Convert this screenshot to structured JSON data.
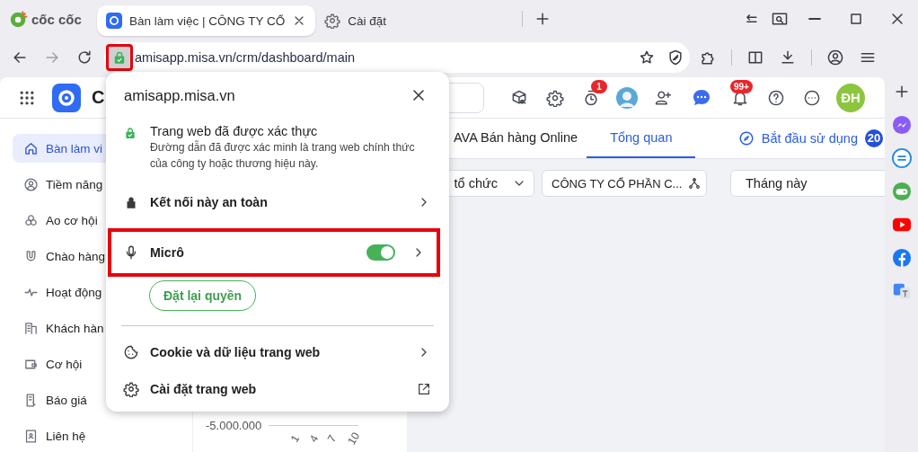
{
  "browser": {
    "brand": "cốc cốc",
    "tabs": [
      {
        "kind": "app",
        "title": "Bàn làm việc | CÔNG TY CỔ",
        "selected": true
      },
      {
        "kind": "settings",
        "title": "Cài đặt",
        "selected": false
      }
    ],
    "address": {
      "url": "amisapp.misa.vn/crm/dashboard/main",
      "lock_highlighted": true
    }
  },
  "app": {
    "title": "C",
    "timer_badge": "1",
    "bell_badge": "99+",
    "user_initials": "ĐH",
    "sidebar": [
      {
        "label": "Bàn làm vi",
        "selected": true
      },
      {
        "label": "Tiềm năng",
        "selected": false
      },
      {
        "label": "Ao cơ hội",
        "selected": false
      },
      {
        "label": "Chào hàng",
        "selected": false
      },
      {
        "label": "Hoạt động",
        "selected": false
      },
      {
        "label": "Khách hàn",
        "selected": false
      },
      {
        "label": "Cơ hội",
        "selected": false
      },
      {
        "label": "Báo giá",
        "selected": false
      },
      {
        "label": "Liên hệ",
        "selected": false
      }
    ],
    "tabs": [
      {
        "label": "AVA Bán hàng Online",
        "selected": false
      },
      {
        "label": "Tổng quan",
        "selected": true
      }
    ],
    "get_started": {
      "label": "Bắt đầu sử dụng",
      "count": "20"
    },
    "filters": [
      {
        "kind": "dropdown",
        "label": "tổ chức"
      },
      {
        "kind": "org",
        "label": "CÔNG TY CỔ PHẦN C..."
      },
      {
        "kind": "plain",
        "label": "Tháng này"
      }
    ],
    "chart": {
      "y_tick": "-5.000.000",
      "x_ticks": [
        "1",
        "4",
        "7",
        "10"
      ]
    }
  },
  "popup": {
    "site": "amisapp.misa.vn",
    "verified_title": "Trang web đã được xác thực",
    "verified_text": "Đường dẫn đã được xác minh là trang web chính thức của công ty hoặc thương hiệu này.",
    "rows": [
      {
        "kind": "link",
        "label": "Kết nối này an toàn",
        "highlighted": false
      },
      {
        "kind": "toggle",
        "label": "Micrô",
        "on": true,
        "highlighted": true
      }
    ],
    "reset_button": "Đặt lại quyền",
    "links": [
      {
        "kind": "link",
        "label": "Cookie và dữ liệu trang web"
      },
      {
        "kind": "external",
        "label": "Cài đặt trang web"
      }
    ]
  }
}
